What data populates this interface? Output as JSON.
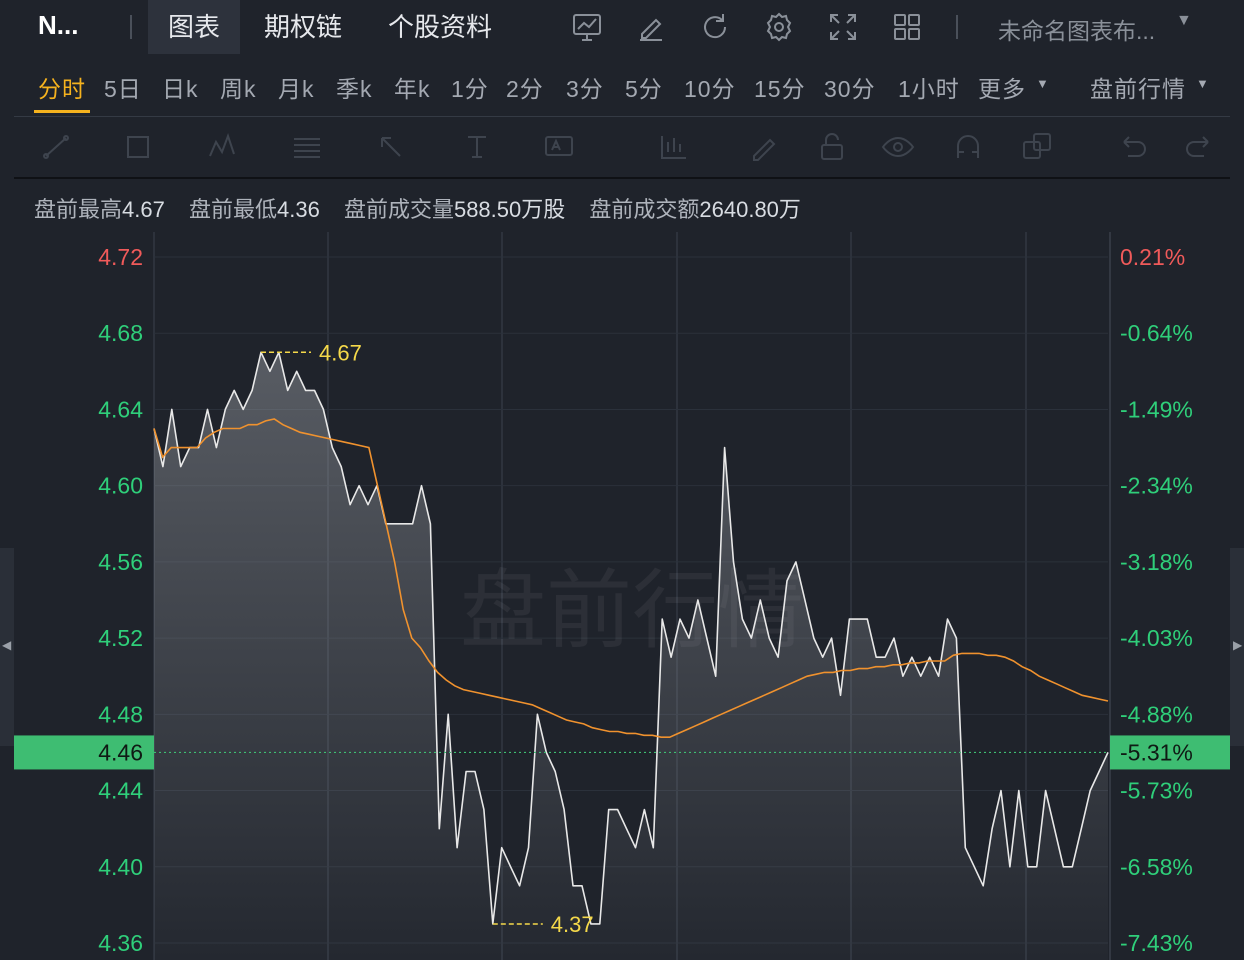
{
  "header": {
    "ticker": "N...",
    "tabs": [
      "图表",
      "期权链",
      "个股资料"
    ],
    "active_tab": "图表",
    "layout_name": "未命名图表布...",
    "toolbar_icons": [
      "chart-monitor-icon",
      "edit-pen-icon",
      "refresh-icon",
      "settings-gear-icon",
      "fullscreen-icon",
      "grid-layout-icon"
    ]
  },
  "periods": {
    "items": [
      "分时",
      "5日",
      "日k",
      "周k",
      "月k",
      "季k",
      "年k",
      "1分",
      "2分",
      "3分",
      "5分",
      "10分",
      "15分",
      "30分",
      "1小时",
      "更多"
    ],
    "active": "分时",
    "session_selector": "盘前行情"
  },
  "drawing_tools": [
    "trend-line-icon",
    "rectangle-icon",
    "pattern-icon",
    "fib-icon",
    "arrow-icon",
    "text-icon",
    "note-icon",
    "indicator-icon",
    "brush-icon",
    "lock-icon",
    "eye-icon",
    "magnet-icon",
    "layers-icon",
    "undo-icon",
    "redo-icon"
  ],
  "stats": {
    "high_label": "盘前最高",
    "high": "4.67",
    "low_label": "盘前最低",
    "low": "4.36",
    "volume_label": "盘前成交量",
    "volume": "588.50万股",
    "amount_label": "盘前成交额",
    "amount": "2640.80万"
  },
  "chart_data": {
    "type": "line",
    "watermark": "盘前行情",
    "ylim": [
      4.36,
      4.72
    ],
    "y_ticks": [
      "4.72",
      "4.68",
      "4.64",
      "4.60",
      "4.56",
      "4.52",
      "4.48",
      "4.44",
      "4.40",
      "4.36"
    ],
    "pct_ticks": [
      "0.21%",
      "-0.64%",
      "-1.49%",
      "-2.34%",
      "-3.18%",
      "-4.03%",
      "-4.88%",
      "-5.73%",
      "-6.58%",
      "-7.43%"
    ],
    "current_price": "4.46",
    "current_pct": "-5.31%",
    "high_marker": "4.67",
    "low_marker": "4.37",
    "grid": true,
    "colors": {
      "price_line": "#e8e8e8",
      "avg_line": "#f0922e",
      "up": "#f05a5a",
      "down": "#2fcf7a",
      "marker": "#f5d94a",
      "badge": "#3ebd72"
    },
    "series": [
      {
        "values": [
          4.63,
          4.61,
          4.64,
          4.61,
          4.62,
          4.62,
          4.64,
          4.62,
          4.64,
          4.65,
          4.64,
          4.65,
          4.67,
          4.66,
          4.67,
          4.65,
          4.66,
          4.65,
          4.65,
          4.64,
          4.62,
          4.61,
          4.59,
          4.6,
          4.59,
          4.6,
          4.58,
          4.58,
          4.58,
          4.58,
          4.6,
          4.58,
          4.42,
          4.48,
          4.41,
          4.45,
          4.45,
          4.43,
          4.37,
          4.41,
          4.4,
          4.39,
          4.41,
          4.48,
          4.46,
          4.45,
          4.43,
          4.39,
          4.39,
          4.37,
          4.37,
          4.43,
          4.43,
          4.42,
          4.41,
          4.43,
          4.41,
          4.53,
          4.51,
          4.53,
          4.52,
          4.54,
          4.52,
          4.5,
          4.62,
          4.56,
          4.53,
          4.52,
          4.54,
          4.52,
          4.51,
          4.55,
          4.56,
          4.54,
          4.52,
          4.51,
          4.52,
          4.49,
          4.53,
          4.53,
          4.53,
          4.51,
          4.51,
          4.52,
          4.5,
          4.51,
          4.5,
          4.51,
          4.5,
          4.53,
          4.52,
          4.41,
          4.4,
          4.39,
          4.42,
          4.44,
          4.4,
          4.44,
          4.4,
          4.4,
          4.44,
          4.42,
          4.4,
          4.4,
          4.42,
          4.44,
          4.45,
          4.46
        ]
      },
      {
        "values": [
          4.63,
          4.615,
          4.62,
          4.62,
          4.62,
          4.62,
          4.625,
          4.628,
          4.63,
          4.63,
          4.63,
          4.632,
          4.632,
          4.634,
          4.635,
          4.632,
          4.63,
          4.628,
          4.627,
          4.626,
          4.625,
          4.624,
          4.623,
          4.622,
          4.621,
          4.62,
          4.6,
          4.58,
          4.56,
          4.535,
          4.52,
          4.515,
          4.508,
          4.502,
          4.498,
          4.495,
          4.493,
          4.492,
          4.491,
          4.49,
          4.489,
          4.488,
          4.487,
          4.486,
          4.485,
          4.483,
          4.481,
          4.479,
          4.477,
          4.476,
          4.475,
          4.473,
          4.472,
          4.471,
          4.471,
          4.47,
          4.47,
          4.469,
          4.469,
          4.468,
          4.468,
          4.47,
          4.472,
          4.474,
          4.476,
          4.478,
          4.48,
          4.482,
          4.484,
          4.486,
          4.488,
          4.49,
          4.492,
          4.494,
          4.496,
          4.498,
          4.5,
          4.501,
          4.502,
          4.502,
          4.503,
          4.503,
          4.504,
          4.504,
          4.505,
          4.505,
          4.506,
          4.506,
          4.507,
          4.507,
          4.508,
          4.508,
          4.508,
          4.511,
          4.512,
          4.512,
          4.512,
          4.511,
          4.511,
          4.51,
          4.508,
          4.505,
          4.503,
          4.5,
          4.498,
          4.496,
          4.494,
          4.492,
          4.49,
          4.489,
          4.488,
          4.487
        ]
      }
    ]
  }
}
